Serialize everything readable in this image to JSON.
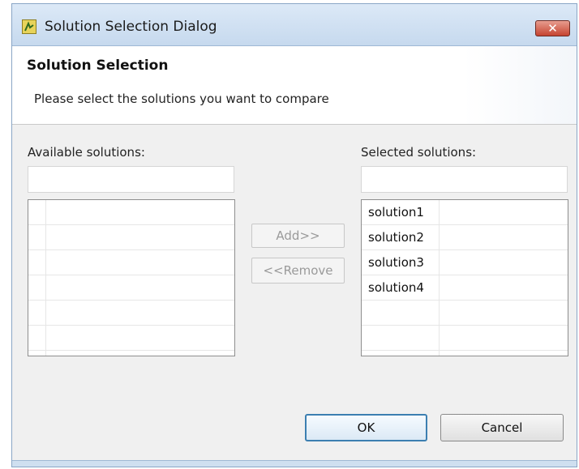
{
  "window": {
    "title": "Solution Selection Dialog",
    "close_label": "✕"
  },
  "header": {
    "title": "Solution Selection",
    "description": "Please select the solutions you want to compare"
  },
  "available": {
    "label": "Available solutions:",
    "filter_value": "",
    "items": [
      "",
      "",
      "",
      "",
      "",
      ""
    ]
  },
  "selected": {
    "label": "Selected solutions:",
    "filter_value": "",
    "items": [
      "solution1",
      "solution2",
      "solution3",
      "solution4",
      "",
      ""
    ]
  },
  "actions": {
    "add_label": "Add>>",
    "remove_label": "<<Remove"
  },
  "footer": {
    "ok_label": "OK",
    "cancel_label": "Cancel"
  },
  "colors": {
    "title_bar": "#c6d9ee",
    "close_button": "#c54431",
    "default_button_border": "#3c7fb1"
  }
}
